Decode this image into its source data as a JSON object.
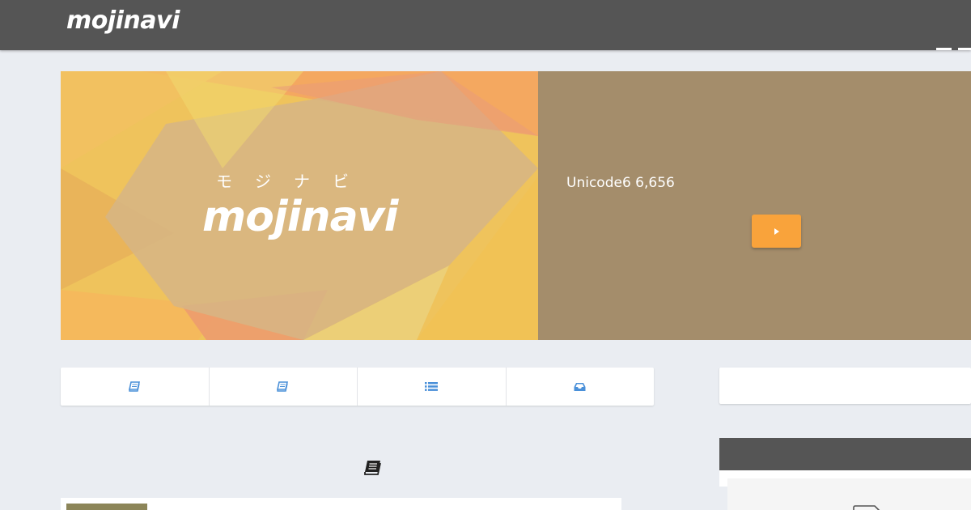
{
  "header": {
    "logo_text": "mojinavi"
  },
  "hero": {
    "kana": "モジナビ",
    "logo_text": "mojinavi",
    "description": "Unicode6 6,656",
    "cta_icon": "play-triangle-icon",
    "panel_color": "#a48d6b",
    "button_color": "#f9a33b"
  },
  "tabs": [
    {
      "icon": "book-icon"
    },
    {
      "icon": "book-icon"
    },
    {
      "icon": "list-icon"
    },
    {
      "icon": "inbox-icon"
    }
  ],
  "section": {
    "icon": "book-icon"
  },
  "colors": {
    "topbar": "#555555",
    "background": "#eaedf2",
    "accent_blue": "#4a90d9"
  }
}
